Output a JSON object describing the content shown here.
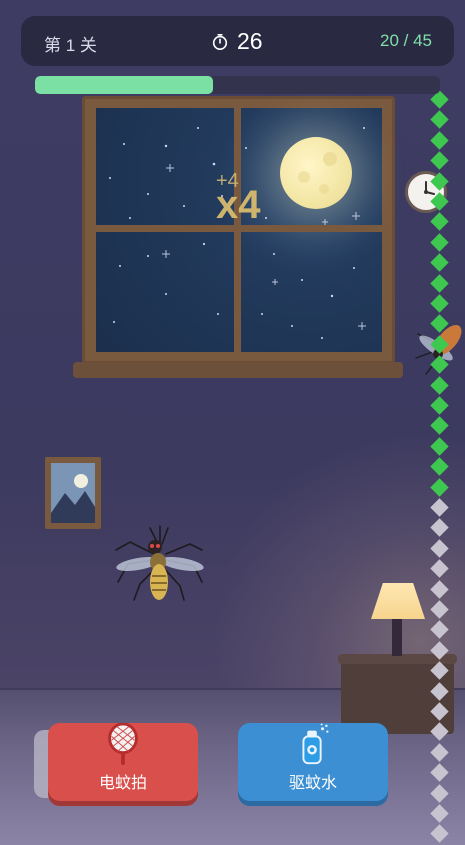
{
  "hud": {
    "level_label": "第 1 关",
    "timer_value": "26",
    "kill_count": "20 / 45",
    "progress_fraction": 0.44
  },
  "combo": {
    "bonus_text": "+4",
    "multiplier_text": "x4"
  },
  "meter": {
    "filled_count": 20,
    "total_count": 37,
    "filled_color": "#3ec84f",
    "empty_color": "#c7c4cf"
  },
  "buttons": {
    "swatter_label": "电蚊拍",
    "repellent_label": "驱蚊水"
  },
  "colors": {
    "hud_bg": "#2a2942",
    "progress_fill": "#7be0a4",
    "swatter": "#d84f4c",
    "repellent": "#3d8fd3"
  },
  "icons": {
    "timer": "stopwatch-icon",
    "swatter": "electric-swatter-icon",
    "repellent": "spray-bottle-icon"
  }
}
